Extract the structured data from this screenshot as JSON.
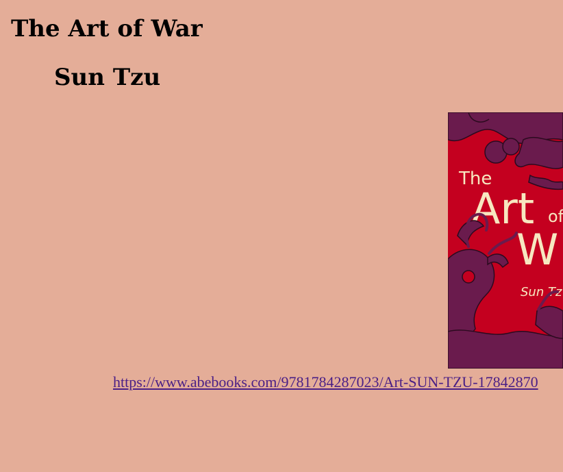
{
  "book": {
    "title": "The Art of War",
    "author": "Sun Tzu"
  },
  "cover": {
    "line_the": "The",
    "line_art": "Art",
    "line_of": "of",
    "line_war": "W",
    "line_author": "Sun Tz",
    "background_color": "#c4001f",
    "pattern_color": "#6a1b4d",
    "text_color": "#f7e7c0"
  },
  "link": {
    "text": "https://www.abebooks.com/9781784287023/Art-SUN-TZU-17842870"
  },
  "colors": {
    "page_background": "#e4ad98",
    "link": "#4a1f86"
  }
}
